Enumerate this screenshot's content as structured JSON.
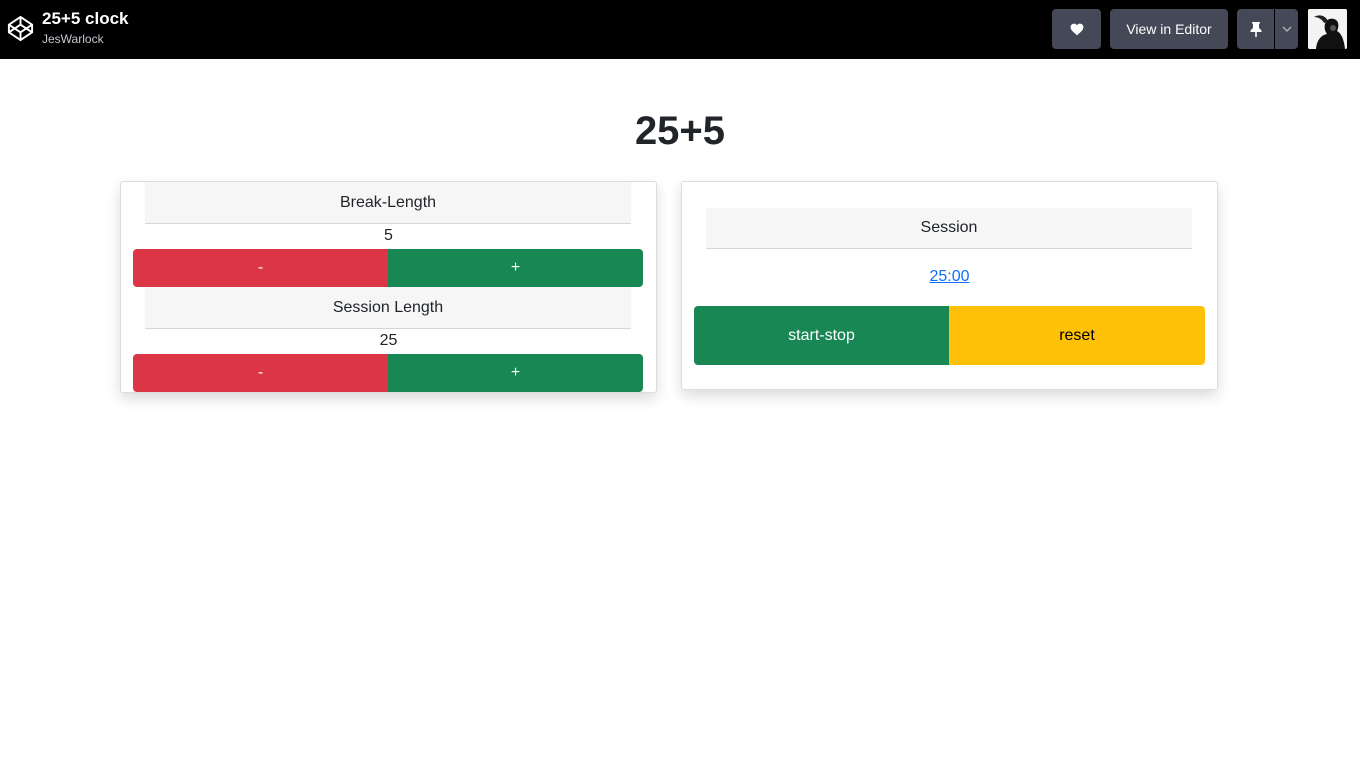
{
  "header": {
    "title": "25+5 clock",
    "author": "JesWarlock",
    "view_in_editor_label": "View in Editor",
    "icons": [
      "codepen-logo-icon",
      "heart-icon",
      "pin-icon",
      "chevron-down-icon",
      "avatar"
    ]
  },
  "main": {
    "title": "25+5",
    "break": {
      "label": "Break-Length",
      "value": "5",
      "decrement_label": "-",
      "increment_label": "+"
    },
    "session_length": {
      "label": "Session Length",
      "value": "25",
      "decrement_label": "-",
      "increment_label": "+"
    },
    "timer": {
      "label": "Session",
      "time": "25:00",
      "start_stop_label": "start-stop",
      "reset_label": "reset"
    }
  },
  "colors": {
    "topbar": "#000000",
    "toolbar_button": "#444857",
    "danger": "#dc3545",
    "success": "#198754",
    "warning": "#ffc107",
    "link": "#0d6efd"
  }
}
